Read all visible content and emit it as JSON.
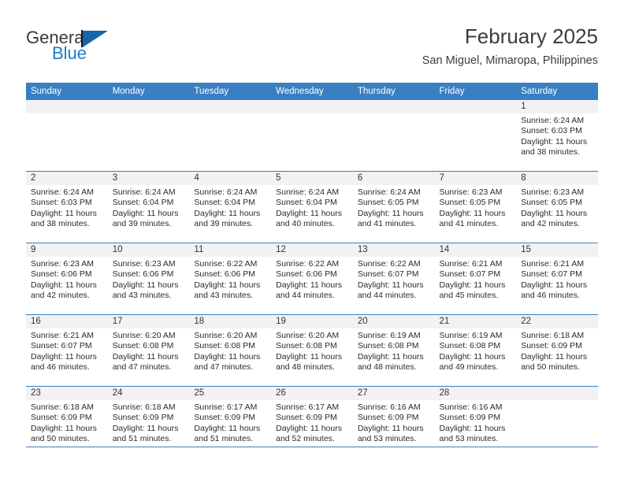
{
  "logo": {
    "word_one": "General",
    "word_two": "Blue",
    "icon": "triangle-flag-icon",
    "accent_color": "#1f7bc1"
  },
  "header": {
    "month_title": "February 2025",
    "location": "San Miguel, Mimaropa, Philippines"
  },
  "calendar": {
    "header_color": "#3a7fc1",
    "date_band_color": "#f2f2f2",
    "weekdays": [
      "Sunday",
      "Monday",
      "Tuesday",
      "Wednesday",
      "Thursday",
      "Friday",
      "Saturday"
    ],
    "weeks": [
      [
        {
          "date": "",
          "lines": []
        },
        {
          "date": "",
          "lines": []
        },
        {
          "date": "",
          "lines": []
        },
        {
          "date": "",
          "lines": []
        },
        {
          "date": "",
          "lines": []
        },
        {
          "date": "",
          "lines": []
        },
        {
          "date": "1",
          "lines": [
            "Sunrise: 6:24 AM",
            "Sunset: 6:03 PM",
            "Daylight: 11 hours",
            "and 38 minutes."
          ]
        }
      ],
      [
        {
          "date": "2",
          "lines": [
            "Sunrise: 6:24 AM",
            "Sunset: 6:03 PM",
            "Daylight: 11 hours",
            "and 38 minutes."
          ]
        },
        {
          "date": "3",
          "lines": [
            "Sunrise: 6:24 AM",
            "Sunset: 6:04 PM",
            "Daylight: 11 hours",
            "and 39 minutes."
          ]
        },
        {
          "date": "4",
          "lines": [
            "Sunrise: 6:24 AM",
            "Sunset: 6:04 PM",
            "Daylight: 11 hours",
            "and 39 minutes."
          ]
        },
        {
          "date": "5",
          "lines": [
            "Sunrise: 6:24 AM",
            "Sunset: 6:04 PM",
            "Daylight: 11 hours",
            "and 40 minutes."
          ]
        },
        {
          "date": "6",
          "lines": [
            "Sunrise: 6:24 AM",
            "Sunset: 6:05 PM",
            "Daylight: 11 hours",
            "and 41 minutes."
          ]
        },
        {
          "date": "7",
          "lines": [
            "Sunrise: 6:23 AM",
            "Sunset: 6:05 PM",
            "Daylight: 11 hours",
            "and 41 minutes."
          ]
        },
        {
          "date": "8",
          "lines": [
            "Sunrise: 6:23 AM",
            "Sunset: 6:05 PM",
            "Daylight: 11 hours",
            "and 42 minutes."
          ]
        }
      ],
      [
        {
          "date": "9",
          "lines": [
            "Sunrise: 6:23 AM",
            "Sunset: 6:06 PM",
            "Daylight: 11 hours",
            "and 42 minutes."
          ]
        },
        {
          "date": "10",
          "lines": [
            "Sunrise: 6:23 AM",
            "Sunset: 6:06 PM",
            "Daylight: 11 hours",
            "and 43 minutes."
          ]
        },
        {
          "date": "11",
          "lines": [
            "Sunrise: 6:22 AM",
            "Sunset: 6:06 PM",
            "Daylight: 11 hours",
            "and 43 minutes."
          ]
        },
        {
          "date": "12",
          "lines": [
            "Sunrise: 6:22 AM",
            "Sunset: 6:06 PM",
            "Daylight: 11 hours",
            "and 44 minutes."
          ]
        },
        {
          "date": "13",
          "lines": [
            "Sunrise: 6:22 AM",
            "Sunset: 6:07 PM",
            "Daylight: 11 hours",
            "and 44 minutes."
          ]
        },
        {
          "date": "14",
          "lines": [
            "Sunrise: 6:21 AM",
            "Sunset: 6:07 PM",
            "Daylight: 11 hours",
            "and 45 minutes."
          ]
        },
        {
          "date": "15",
          "lines": [
            "Sunrise: 6:21 AM",
            "Sunset: 6:07 PM",
            "Daylight: 11 hours",
            "and 46 minutes."
          ]
        }
      ],
      [
        {
          "date": "16",
          "lines": [
            "Sunrise: 6:21 AM",
            "Sunset: 6:07 PM",
            "Daylight: 11 hours",
            "and 46 minutes."
          ]
        },
        {
          "date": "17",
          "lines": [
            "Sunrise: 6:20 AM",
            "Sunset: 6:08 PM",
            "Daylight: 11 hours",
            "and 47 minutes."
          ]
        },
        {
          "date": "18",
          "lines": [
            "Sunrise: 6:20 AM",
            "Sunset: 6:08 PM",
            "Daylight: 11 hours",
            "and 47 minutes."
          ]
        },
        {
          "date": "19",
          "lines": [
            "Sunrise: 6:20 AM",
            "Sunset: 6:08 PM",
            "Daylight: 11 hours",
            "and 48 minutes."
          ]
        },
        {
          "date": "20",
          "lines": [
            "Sunrise: 6:19 AM",
            "Sunset: 6:08 PM",
            "Daylight: 11 hours",
            "and 48 minutes."
          ]
        },
        {
          "date": "21",
          "lines": [
            "Sunrise: 6:19 AM",
            "Sunset: 6:08 PM",
            "Daylight: 11 hours",
            "and 49 minutes."
          ]
        },
        {
          "date": "22",
          "lines": [
            "Sunrise: 6:18 AM",
            "Sunset: 6:09 PM",
            "Daylight: 11 hours",
            "and 50 minutes."
          ]
        }
      ],
      [
        {
          "date": "23",
          "lines": [
            "Sunrise: 6:18 AM",
            "Sunset: 6:09 PM",
            "Daylight: 11 hours",
            "and 50 minutes."
          ]
        },
        {
          "date": "24",
          "lines": [
            "Sunrise: 6:18 AM",
            "Sunset: 6:09 PM",
            "Daylight: 11 hours",
            "and 51 minutes."
          ]
        },
        {
          "date": "25",
          "lines": [
            "Sunrise: 6:17 AM",
            "Sunset: 6:09 PM",
            "Daylight: 11 hours",
            "and 51 minutes."
          ]
        },
        {
          "date": "26",
          "lines": [
            "Sunrise: 6:17 AM",
            "Sunset: 6:09 PM",
            "Daylight: 11 hours",
            "and 52 minutes."
          ]
        },
        {
          "date": "27",
          "lines": [
            "Sunrise: 6:16 AM",
            "Sunset: 6:09 PM",
            "Daylight: 11 hours",
            "and 53 minutes."
          ]
        },
        {
          "date": "28",
          "lines": [
            "Sunrise: 6:16 AM",
            "Sunset: 6:09 PM",
            "Daylight: 11 hours",
            "and 53 minutes."
          ]
        },
        {
          "date": "",
          "lines": []
        }
      ]
    ]
  }
}
